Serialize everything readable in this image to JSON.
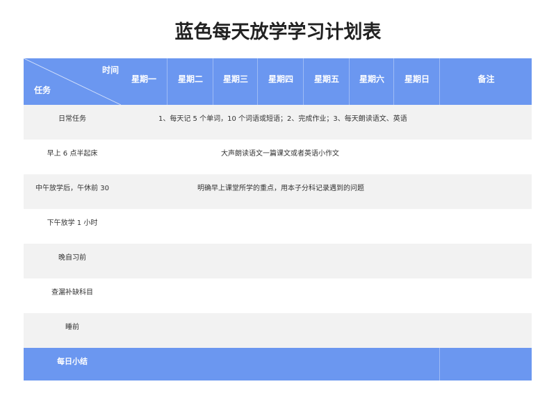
{
  "title": "蓝色每天放学学习计划表",
  "header": {
    "corner_time": "时间",
    "corner_task": "任务",
    "days": [
      "星期一",
      "星期二",
      "星期三",
      "星期四",
      "星期五",
      "星期六",
      "星期日"
    ],
    "notes": "备注"
  },
  "rows": [
    {
      "task": "日常任务",
      "content": "1、每天记 5 个单词，10 个词语或短语；2、完成作业；3、每天朗读语文、英语"
    },
    {
      "task": "早上 6 点半起床",
      "content": "大声朗读语文一篇课文或者英语小作文"
    },
    {
      "task": "中午放学后，午休前 30",
      "content": "明确早上课堂所学的重点，用本子分科记录遇到的问题"
    },
    {
      "task": "下午放学 1 小时",
      "content": ""
    },
    {
      "task": "晚自习前",
      "content": ""
    },
    {
      "task": "查漏补缺科目",
      "content": ""
    },
    {
      "task": "睡前",
      "content": ""
    }
  ],
  "footer": {
    "task": "每日小结"
  },
  "colors": {
    "header_bg": "#6b97f0",
    "row_shade": "#f2f2f2"
  }
}
